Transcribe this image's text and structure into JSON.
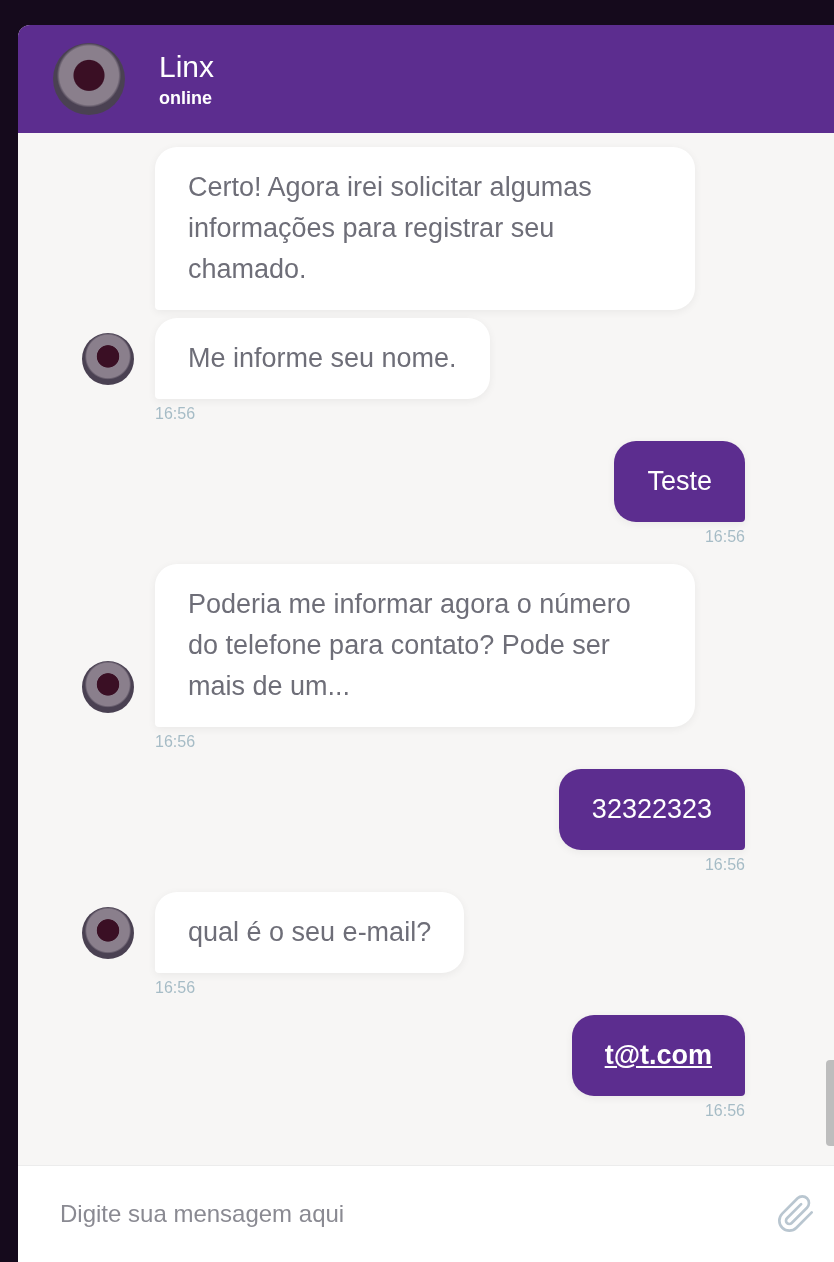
{
  "header": {
    "name": "Linx",
    "status": "online"
  },
  "messages": [
    {
      "kind": "bot",
      "text": "Certo! Agora irei solicitar algumas informações para registrar seu chamado.",
      "avatar": false
    },
    {
      "kind": "bot",
      "text": "Me informe seu nome.",
      "avatar": true,
      "time": "16:56"
    },
    {
      "kind": "user",
      "text": "Teste",
      "time": "16:56"
    },
    {
      "kind": "bot",
      "text": "Poderia me informar agora o número do telefone para contato? Pode ser mais de um...",
      "avatar": true,
      "time": "16:56"
    },
    {
      "kind": "user",
      "text": "32322323",
      "time": "16:56"
    },
    {
      "kind": "bot",
      "text": "qual é o seu e-mail?",
      "avatar": true,
      "time": "16:56"
    },
    {
      "kind": "user_link",
      "text": "t@t.com",
      "time": "16:56"
    }
  ],
  "composer": {
    "placeholder": "Digite sua mensagem aqui"
  }
}
